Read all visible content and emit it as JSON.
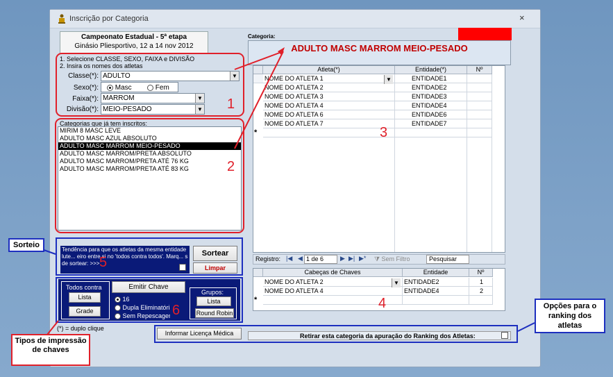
{
  "window": {
    "title": "Inscrição por Categoria",
    "close_glyph": "×",
    "header_title": "Campeonato Estadual - 5ª etapa",
    "header_subtitle": "Ginásio Pliesportivo, 12 a 14 nov 2012"
  },
  "form": {
    "instruction1": "1. Selecione CLASSE, SEXO, FAIXA e DIVISÃO",
    "instruction2": "2. Insira os nomes dos atletas",
    "classe_label": "Classe(*):",
    "classe_value": "ADULTO",
    "sexo_label": "Sexo(*):",
    "sexo_masc": "Masc",
    "sexo_fem": "Fem",
    "faixa_label": "Faixa(*):",
    "faixa_value": "MARROM",
    "divisao_label": "Divisão(*):",
    "divisao_value": "MEIO-PESADO"
  },
  "categories": {
    "label": "Categorias que já tem inscritos:",
    "items": [
      "MIRIM 8 MASC  LEVE",
      "ADULTO MASC AZUL ABSOLUTO",
      "ADULTO MASC MARROM MEIO-PESADO",
      "ADULTO MASC MARROM/PRETA ABSOLUTO",
      "ADULTO MASC MARROM/PRETA ATÉ 76 KG",
      "ADULTO MASC MARROM/PRETA ATÉ 83 KG"
    ],
    "selected_index": 2
  },
  "sorteio": {
    "text": "Tendência para que os atletas da mesma entidade lute... eiro entre si no 'todos contra todos'. Marq... s de sortear: >>>",
    "sortear_label": "Sortear",
    "limpar_label": "Limpar"
  },
  "chaves": {
    "todos_contra_label": "Todos contra",
    "lista_label": "Lista",
    "grade_label": "Grade",
    "emitir_label": "Emitir Chave",
    "opt_16": "16",
    "opt_dupla": "Dupla Eliminatória",
    "opt_sem": "Sem Repescagem",
    "grupos_label": "Grupos:",
    "grupos_lista": "Lista",
    "round_robin": "Round Robin"
  },
  "footnote": "(*) = duplo clique",
  "licenca_button": "Informar Licença Médica",
  "categoria": {
    "label": "Categoria:",
    "name": "ADULTO MASC MARROM MEIO-PESADO"
  },
  "athletes_grid": {
    "headers": [
      "Atleta(*)",
      "Entidade(*)",
      "Nº"
    ],
    "rows": [
      [
        "NOME DO ATLETA 1",
        "ENTIDADE1",
        ""
      ],
      [
        "NOME DO ATLETA 2",
        "ENTIDADE2",
        ""
      ],
      [
        "NOME DO ATLETA 3",
        "ENTIDADE3",
        ""
      ],
      [
        "NOME DO ATLETA 4",
        "ENTIDADE4",
        ""
      ],
      [
        "NOME DO ATLETA 6",
        "ENTIDADE6",
        ""
      ],
      [
        "NOME DO ATLETA 7",
        "ENTIDADE7",
        ""
      ]
    ],
    "new_row_marker": "*"
  },
  "nav": {
    "registro_label": "Registro:",
    "position": "1 de 6",
    "sem_filtro": "Sem Filtro",
    "pesquisar": "Pesquisar"
  },
  "heads_grid": {
    "headers": [
      "Cabeças de Chaves",
      "Entidade",
      "Nº"
    ],
    "rows": [
      [
        "NOME DO ATLETA 2",
        "ENTIDADE2",
        "1"
      ],
      [
        "NOME DO ATLETA 4",
        "ENTIDADE4",
        "2"
      ]
    ],
    "new_row_marker": "*"
  },
  "retirar_label": "Retirar esta categoria da apuração do Ranking dos Atletas:",
  "annotations": {
    "n1": "1",
    "n2": "2",
    "n3": "3",
    "n4": "4",
    "n5": "5",
    "n6": "6",
    "sorteio_callout": "Sorteio",
    "tipos_callout": "Tipos de impressão de chaves",
    "opcoes_callout": "Opções para o ranking dos atletas"
  },
  "colors": {
    "accent_red": "#e0202a",
    "accent_blue": "#1d2fbf",
    "navy_panel": "#0a1a78",
    "category_title": "#c00000"
  }
}
